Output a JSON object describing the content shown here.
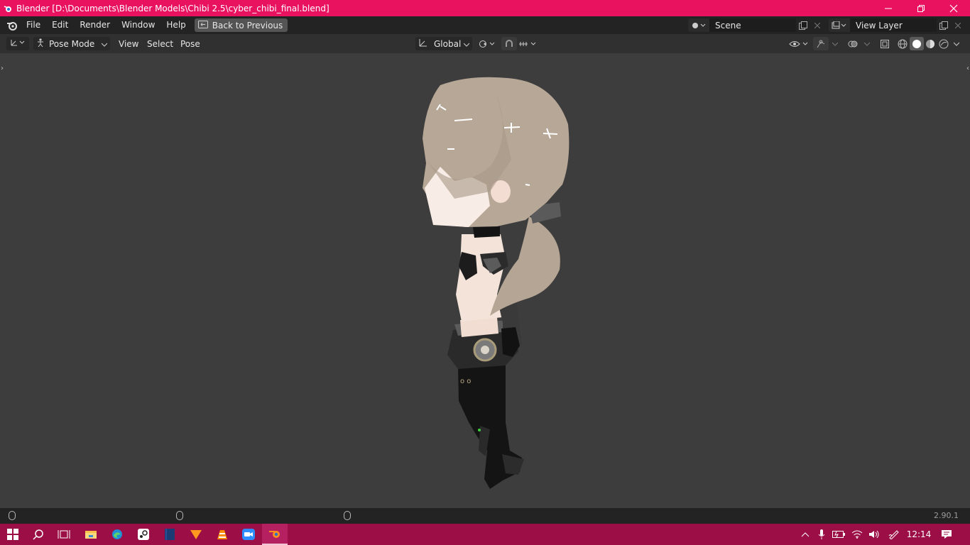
{
  "window": {
    "title": "Blender [D:\\Documents\\Blender Models\\Chibi 2.5\\cyber_chibi_final.blend]",
    "controls": [
      "minimize",
      "restore",
      "close"
    ]
  },
  "menubar": {
    "items": [
      "File",
      "Edit",
      "Render",
      "Window",
      "Help"
    ],
    "back_label": "Back to Previous",
    "scene_name": "Scene",
    "view_layer_name": "View Layer"
  },
  "viewport_header": {
    "mode": "Pose Mode",
    "menus": [
      "View",
      "Select",
      "Pose"
    ],
    "orientation": "Global"
  },
  "statusbar": {
    "version": "2.90.1"
  },
  "taskbar": {
    "time": "12:14",
    "accent": "#9c0f46",
    "apps": [
      "start-icon",
      "search-icon",
      "task-view-icon",
      "file-explorer-icon",
      "edge-icon",
      "steam-icon",
      "book-icon",
      "arrow-app-icon",
      "vlc-icon",
      "zoom-icon",
      "blender-icon"
    ]
  },
  "colors": {
    "titlebar": "#e8125f",
    "viewport_bg": "#3d3d3d"
  }
}
